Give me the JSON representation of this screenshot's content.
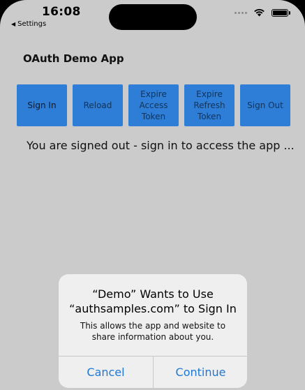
{
  "status_bar": {
    "time": "16:08",
    "back_label": "Settings",
    "icons": [
      "signal-dots-icon",
      "wifi-icon",
      "battery-icon"
    ]
  },
  "app": {
    "title": "OAuth Demo App",
    "buttons": [
      {
        "label": "Sign In"
      },
      {
        "label": "Reload"
      },
      {
        "label": "Expire\nAccess\nToken"
      },
      {
        "label": "Expire\nRefresh\nToken"
      },
      {
        "label": "Sign Out"
      }
    ],
    "message": "You are signed out - sign in to access the app ..."
  },
  "dialog": {
    "title": "“Demo” Wants to Use\n“authsamples.com” to Sign In",
    "message": "This allows the app and website to share information about you.",
    "cancel_label": "Cancel",
    "continue_label": "Continue"
  },
  "colors": {
    "background": "#cbcbcb",
    "button": "#2e7dd6",
    "dialog_button_text": "#1e78d7"
  }
}
